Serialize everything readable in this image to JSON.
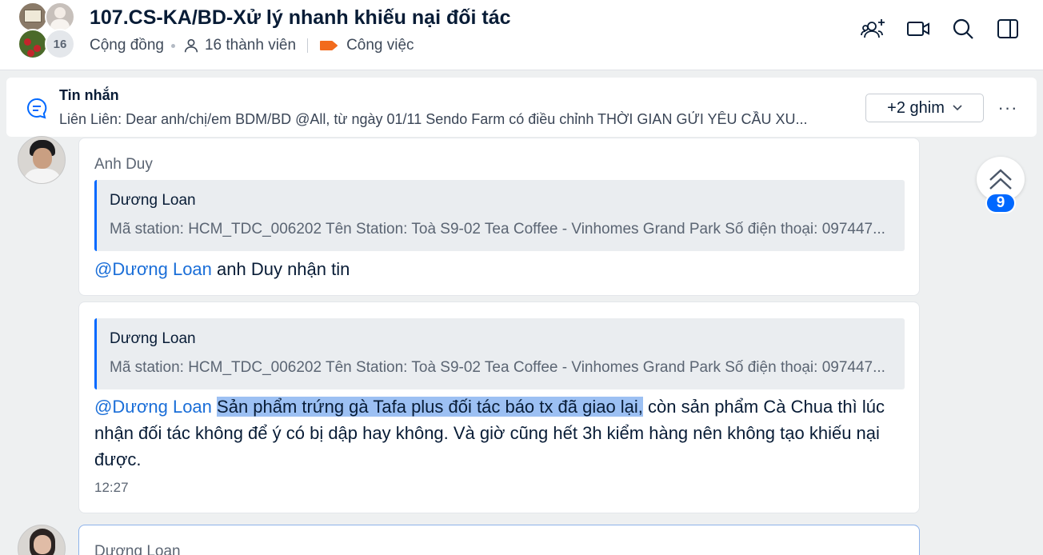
{
  "header": {
    "title": "107.CS-KA/BD-Xử lý nhanh khiếu nại đối tác",
    "community_label": "Cộng đồng",
    "member_count_label": "16 thành viên",
    "category_label": "Công việc",
    "avatar_more_count": "16",
    "accent_color": "#f26b1d",
    "icons": [
      "add-member-icon",
      "video-call-icon",
      "search-icon",
      "sidebar-toggle-icon"
    ]
  },
  "pinned": {
    "title": "Tin nhắn",
    "text": "Liên Liên: Dear anh/chị/em BDM/BD @All, từ ngày 01/11 Sendo Farm có điều chỉnh THỜI GIAN GỬI YÊU CẦU XU...",
    "pins_button": "+2 ghim",
    "more_label": "···"
  },
  "messages": [
    {
      "sender": "Anh Duy",
      "quote": {
        "name": "Dương Loan",
        "text": "Mã station: HCM_TDC_006202 Tên Station: Toà S9-02 Tea Coffee - Vinhomes Grand Park Số điện thoại: 097447..."
      },
      "mention": "@Dương Loan",
      "text": " anh Duy nhận tin"
    },
    {
      "quote": {
        "name": "Dương Loan",
        "text": "Mã station: HCM_TDC_006202 Tên Station: Toà S9-02 Tea Coffee - Vinhomes Grand Park Số điện thoại: 097447..."
      },
      "mention": "@Dương Loan",
      "highlighted": "Sản phẩm trứng gà Tafa plus đối tác báo tx đã giao lại,",
      "text": " còn sản phẩm Cà Chua thì lúc nhận đối tác không để ý có bị dập hay không. Và giờ cũng hết 3h kiểm hàng nên không tạo khiếu nại được.",
      "time": "12:27"
    },
    {
      "sender": "Dương Loan"
    }
  ],
  "scroll": {
    "unread_count": "9"
  }
}
